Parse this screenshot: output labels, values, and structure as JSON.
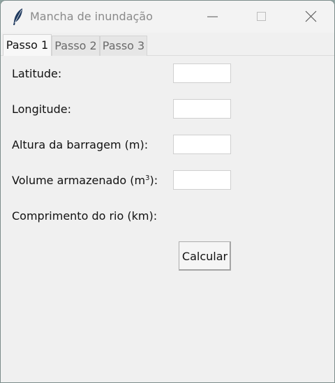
{
  "window": {
    "title": "Mancha de inundação"
  },
  "tabs": [
    {
      "label": "Passo 1",
      "active": true
    },
    {
      "label": "Passo 2",
      "active": false
    },
    {
      "label": "Passo 3",
      "active": false
    }
  ],
  "form": {
    "latitude_label": "Latitude:",
    "longitude_label": "Longitude:",
    "altura_label": "Altura da barragem (m):",
    "volume_label_pre": "Volume armazenado (m",
    "volume_label_sup": "3",
    "volume_label_post": "):",
    "comprimento_label": "Comprimento do rio (km):",
    "latitude_value": "",
    "longitude_value": "",
    "altura_value": "",
    "volume_value": "",
    "calcular_label": "Calcular"
  },
  "icons": {
    "app": "feather-icon",
    "minimize": "minimize-icon",
    "maximize": "maximize-icon",
    "close": "close-icon"
  },
  "colors": {
    "window_bg": "#f0f0f0",
    "titlebar_bg": "#f3f3f3",
    "title_text": "#8a8a8a",
    "field_bg": "#ffffff"
  }
}
